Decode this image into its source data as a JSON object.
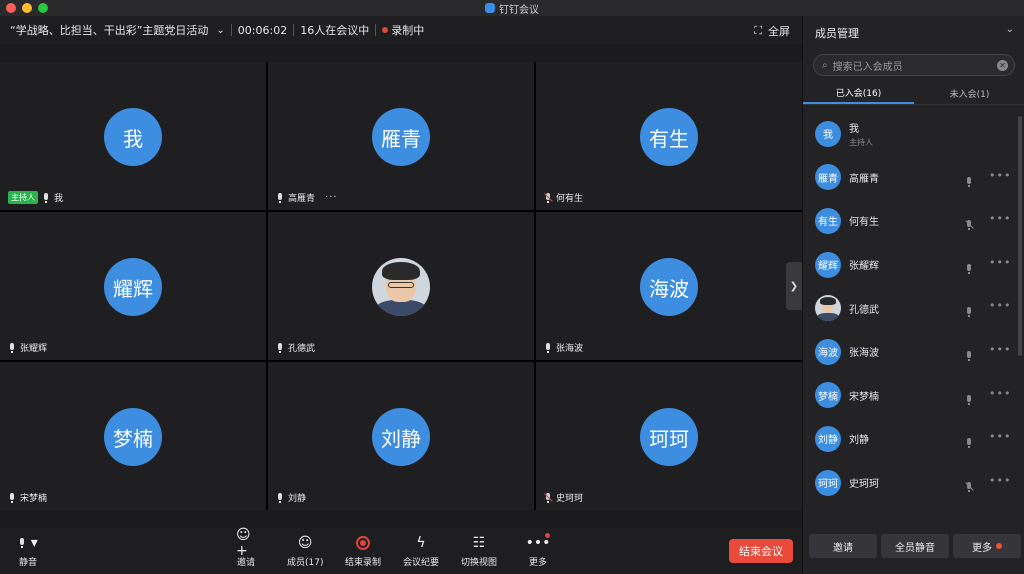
{
  "window": {
    "app_title": "钉钉会议"
  },
  "header": {
    "meeting_title": "“学战略、比担当、干出彩”主题党日活动",
    "duration": "00:06:02",
    "participants_in_meeting": "16人在会议中",
    "recording_label": "录制中",
    "fullscreen_label": "全屏"
  },
  "colors": {
    "accent": "#3d8ee0",
    "host_badge": "#2bb24c",
    "end_button": "#e84a3b",
    "recording": "#e0443a"
  },
  "tiles": [
    {
      "avatar_text": "我",
      "name": "我",
      "host_badge": "主持人",
      "mic": "on"
    },
    {
      "avatar_text": "雁青",
      "name": "高雁青",
      "mic": "on",
      "more": "···"
    },
    {
      "avatar_text": "有生",
      "name": "何有生",
      "mic": "muted"
    },
    {
      "avatar_text": "耀辉",
      "name": "张耀辉",
      "mic": "on"
    },
    {
      "avatar_text": "",
      "name": "孔德武",
      "mic": "on",
      "photo": true
    },
    {
      "avatar_text": "海波",
      "name": "张海波",
      "mic": "on"
    },
    {
      "avatar_text": "梦楠",
      "name": "宋梦楠",
      "mic": "on"
    },
    {
      "avatar_text": "刘静",
      "name": "刘静",
      "mic": "on"
    },
    {
      "avatar_text": "珂珂",
      "name": "史珂珂",
      "mic": "muted"
    }
  ],
  "toolbar": {
    "mute_label": "静音",
    "invite_label": "邀请",
    "members_label": "成员(17)",
    "end_recording_label": "结束录制",
    "minutes_label": "会议纪要",
    "switch_view_label": "切换视图",
    "more_label": "更多",
    "end_meeting_label": "结束会议"
  },
  "panel": {
    "title": "成员管理",
    "search_placeholder": "搜索已入会成员",
    "tab_joined": "已入会(16)",
    "tab_not_joined": "未入会(1)",
    "members": [
      {
        "avatar_text": "我",
        "name": "我",
        "role": "主持人"
      },
      {
        "avatar_text": "雁青",
        "name": "高雁青"
      },
      {
        "avatar_text": "有生",
        "name": "何有生",
        "mic": "muted"
      },
      {
        "avatar_text": "耀辉",
        "name": "张耀辉"
      },
      {
        "avatar_text": "",
        "name": "孔德武",
        "photo": true
      },
      {
        "avatar_text": "海波",
        "name": "张海波"
      },
      {
        "avatar_text": "梦楠",
        "name": "宋梦楠"
      },
      {
        "avatar_text": "刘静",
        "name": "刘静"
      },
      {
        "avatar_text": "珂珂",
        "name": "史珂珂",
        "mic": "muted"
      }
    ],
    "invite_label": "邀请",
    "mute_all_label": "全员静音",
    "more_label": "更多"
  }
}
